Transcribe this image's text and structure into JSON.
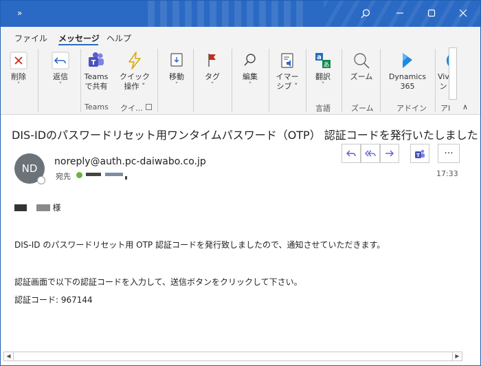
{
  "titlebar": {
    "expand_glyph": "»",
    "search_icon": "search-icon",
    "minimize_icon": "minimize-icon",
    "maximize_icon": "maximize-icon",
    "close_icon": "close-icon"
  },
  "menu": {
    "tabs": [
      {
        "label": "ファイル"
      },
      {
        "label": "メッセージ",
        "active": true
      },
      {
        "label": "ヘルプ"
      }
    ]
  },
  "ribbon": {
    "buttons": {
      "delete": {
        "label": "削除",
        "caret": "˅"
      },
      "reply": {
        "label": "返信",
        "caret": "˅"
      },
      "teams_share": {
        "label1": "Teams",
        "label2": "で共有"
      },
      "quick_steps": {
        "label1": "クイック",
        "label2": "操作 ˅"
      },
      "move": {
        "label": "移動",
        "caret": "˅"
      },
      "tags": {
        "label": "タグ",
        "caret": "˅"
      },
      "editing": {
        "label": "編集",
        "caret": "˅"
      },
      "immersive": {
        "label1": "イマー",
        "label2": "シブ ˅"
      },
      "translate": {
        "label": "翻訳",
        "caret": "˅"
      },
      "zoom": {
        "label": "ズーム"
      },
      "dynamics": {
        "label1": "Dynamics",
        "label2": "365"
      },
      "viva": {
        "label1": "Viv",
        "label2": "ン"
      }
    },
    "groups": {
      "teams": "Teams",
      "quick": "クイ…",
      "language": "言語",
      "zoom": "ズーム",
      "addin": "アドイン",
      "cut": "アI"
    },
    "collapse_glyph": "∧"
  },
  "message": {
    "subject": "DIS-IDのパスワードリセット用ワンタイムパスワード（OTP） 認証コードを発行いたしました",
    "avatar_initials": "ND",
    "from": "noreply@auth.pc-daiwabo.co.jp",
    "to_label": "宛先",
    "time": "17:33",
    "more_glyph": "···",
    "greeting_suffix": "様",
    "body_line1": "DIS-ID のパスワードリセット用 OTP 認証コードを発行致しましたので、通知させていただきます。",
    "body_line2": "認証画面で以下の認証コードを入力して、送信ボタンをクリックして下さい。",
    "body_line3": "認証コード: 967144"
  },
  "colors": {
    "titlebar": "#2a69c4",
    "accent": "#2a69c4",
    "teams_purple": "#5b5fc7",
    "flag_red": "#c42b1c"
  }
}
